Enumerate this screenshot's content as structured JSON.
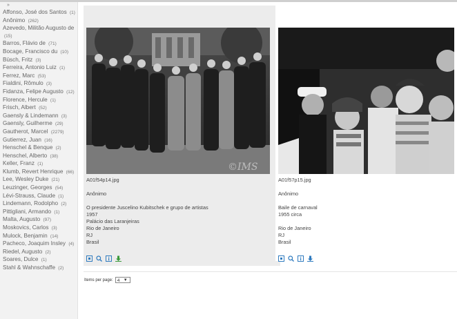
{
  "sidebar": {
    "toggle": "»",
    "items": [
      {
        "name": "Affonso, José dos Santos",
        "count": "(1)"
      },
      {
        "name": "Anônimo",
        "count": "(262)"
      },
      {
        "name": "Azevedo, Militão Augusto de",
        "count": "(15)"
      },
      {
        "name": "Barros, Flávio de",
        "count": "(71)"
      },
      {
        "name": "Bocage, Francisco du",
        "count": "(10)"
      },
      {
        "name": "Büsch, Fritz",
        "count": "(3)"
      },
      {
        "name": "Ferreira, Antonio Luiz",
        "count": "(1)"
      },
      {
        "name": "Ferrez, Marc",
        "count": "(53)"
      },
      {
        "name": "Fialdini, Rômulo",
        "count": "(3)"
      },
      {
        "name": "Fidanza, Felipe Augusto",
        "count": "(12)"
      },
      {
        "name": "Florence, Hercule",
        "count": "(1)"
      },
      {
        "name": "Frisch, Albert",
        "count": "(52)"
      },
      {
        "name": "Gaensly & Lindemann",
        "count": "(3)"
      },
      {
        "name": "Gaensly, Guilherme",
        "count": "(29)"
      },
      {
        "name": "Gautherot, Marcel",
        "count": "(2279)"
      },
      {
        "name": "Gutierrez, Juan",
        "count": "(16)"
      },
      {
        "name": "Henschel & Benque",
        "count": "(2)"
      },
      {
        "name": "Henschel, Alberto",
        "count": "(38)"
      },
      {
        "name": "Keller, Franz",
        "count": "(1)"
      },
      {
        "name": "Klumb, Revert Henrique",
        "count": "(66)"
      },
      {
        "name": "Lee, Wesley Duke",
        "count": "(21)"
      },
      {
        "name": "Leuzinger, Georges",
        "count": "(54)"
      },
      {
        "name": "Lévi-Strauss, Claude",
        "count": "(1)"
      },
      {
        "name": "Lindemann, Rodolpho",
        "count": "(2)"
      },
      {
        "name": "Pittigliani, Armando",
        "count": "(1)"
      },
      {
        "name": "Malta, Augusto",
        "count": "(97)"
      },
      {
        "name": "Moskovics, Carlos",
        "count": "(3)"
      },
      {
        "name": "Mulock, Benjamin",
        "count": "(14)"
      },
      {
        "name": "Pacheco, Joaquim Insley",
        "count": "(4)"
      },
      {
        "name": "Riedel, Augusto",
        "count": "(2)"
      },
      {
        "name": "Soares, Dulce",
        "count": "(1)"
      },
      {
        "name": "Stahl & Wahnschaffe",
        "count": "(2)"
      }
    ]
  },
  "results": [
    {
      "filename": "A01f54p14.jpg",
      "author": "Anônimo",
      "lines": [
        "O presidente Juscelino Kubitschek e grupo de artistas",
        "1957",
        "Palácio das Laranjeiras",
        "Rio de Janeiro",
        "RJ",
        "Brasil"
      ],
      "watermark": "©IMS"
    },
    {
      "filename": "A01f57p15.jpg",
      "author": "Anônimo",
      "lines": [
        "Baile de carnaval",
        "1955 circa",
        "",
        "Rio de Janeiro",
        "RJ",
        "Brasil"
      ]
    }
  ],
  "pager": {
    "label": "Items per page:",
    "value": "4",
    "arrow": "▼"
  },
  "colors": {
    "sidebar_bg": "#f2f2f2",
    "card_bg": "#ececec",
    "icon_blue": "#2f7bbf",
    "icon_green": "#3a9a3a"
  }
}
